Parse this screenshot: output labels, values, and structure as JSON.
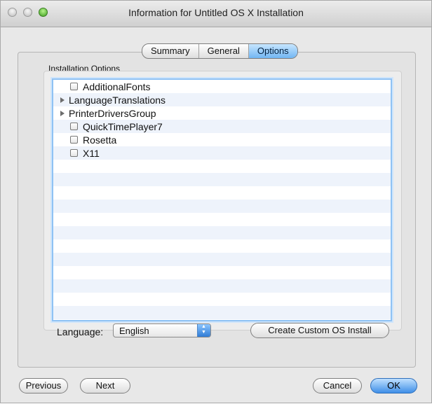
{
  "window": {
    "title": "Information for Untitled OS X Installation"
  },
  "tabs": [
    {
      "label": "Summary",
      "active": false
    },
    {
      "label": "General",
      "active": false
    },
    {
      "label": "Options",
      "active": true
    }
  ],
  "options": {
    "group_title": "Installation Options",
    "items": [
      {
        "label": "AdditionalFonts",
        "type": "checkbox",
        "checked": false
      },
      {
        "label": "LanguageTranslations",
        "type": "disclosure"
      },
      {
        "label": "PrinterDriversGroup",
        "type": "disclosure"
      },
      {
        "label": "QuickTimePlayer7",
        "type": "checkbox",
        "checked": false
      },
      {
        "label": "Rosetta",
        "type": "checkbox",
        "checked": false
      },
      {
        "label": "X11",
        "type": "checkbox",
        "checked": false
      }
    ]
  },
  "language": {
    "label": "Language:",
    "value": "English"
  },
  "buttons": {
    "create_custom": "Create Custom OS Install",
    "previous": "Previous",
    "next": "Next",
    "cancel": "Cancel",
    "ok": "OK"
  },
  "colors": {
    "accent": "#3f8fe7",
    "list_focus": "#8fc2f4"
  }
}
